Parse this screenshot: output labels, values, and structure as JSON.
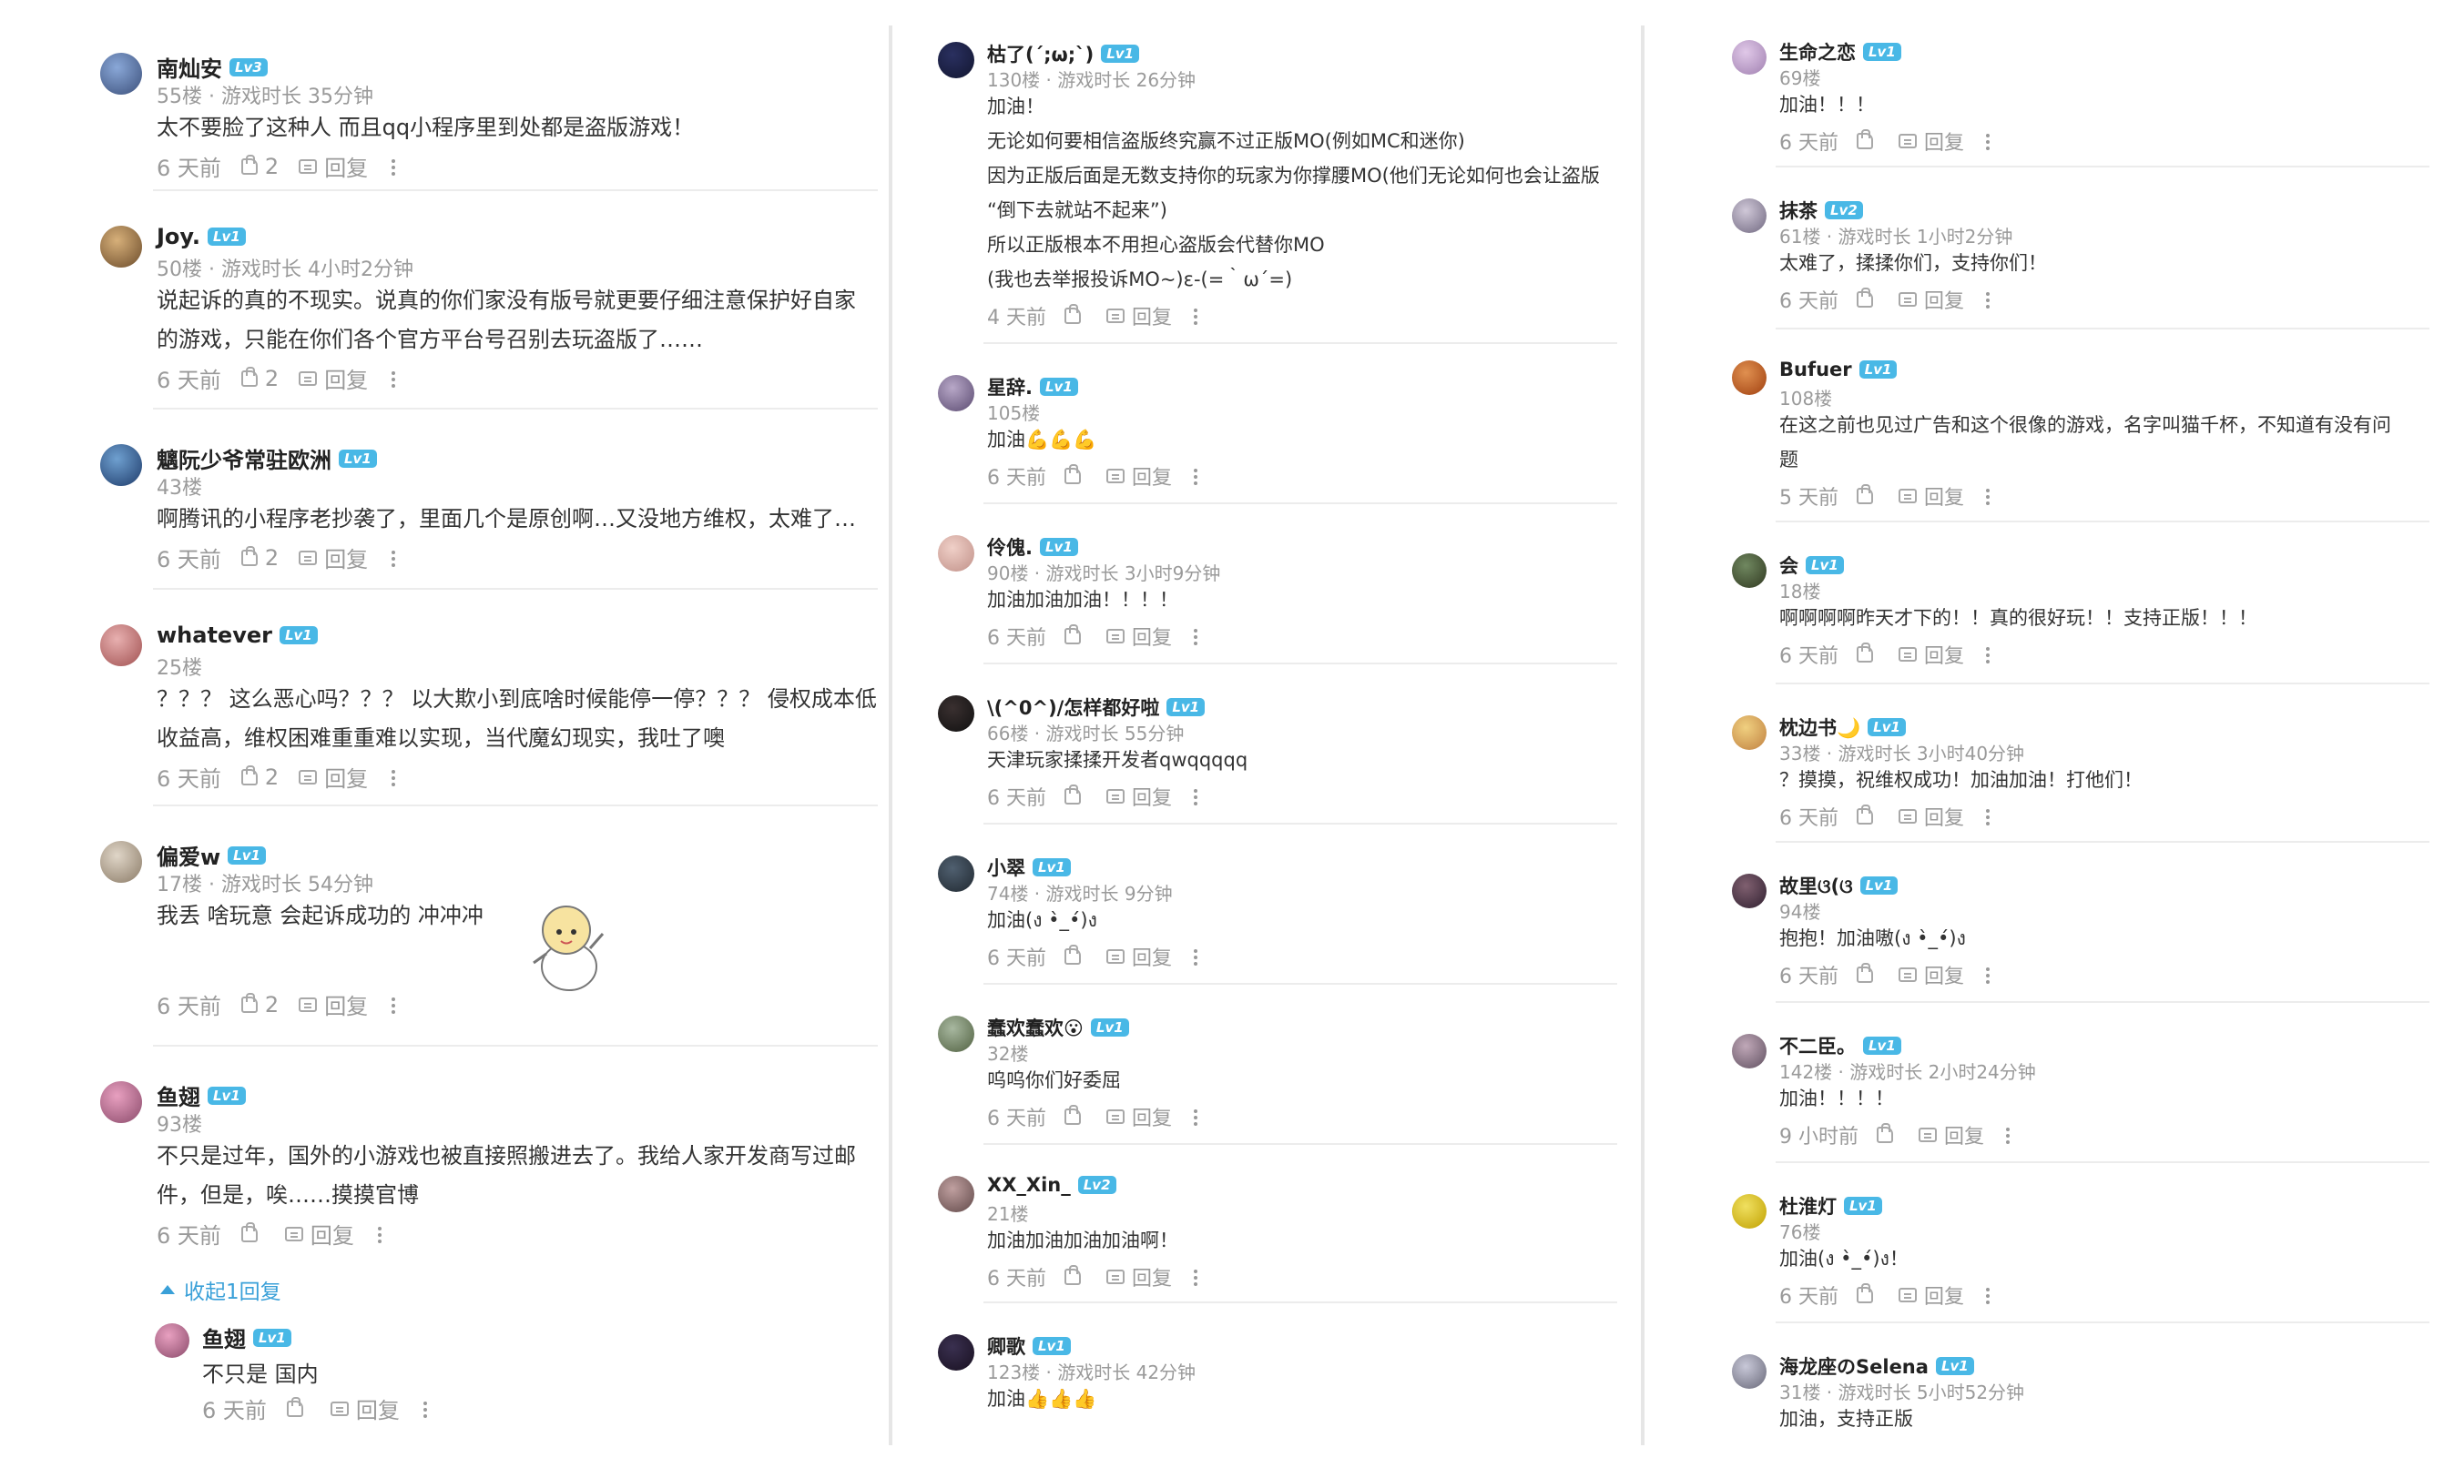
{
  "columns": [
    {
      "comments": [
        {
          "user": "南灿安",
          "level": "Lv3",
          "meta": "55楼 · 游戏时长 35分钟",
          "lines": [
            "太不要脸了这种人 而且qq小程序里到处都是盗版游戏！"
          ],
          "time": "6 天前",
          "likes": "2",
          "reply_label": "回复"
        },
        {
          "user": "Joy.",
          "level": "Lv1",
          "meta": "50楼 · 游戏时长 4小时2分钟",
          "lines": [
            "说起诉的真的不现实。说真的你们家没有版号就更要仔细注意保护好自家",
            "的游戏，只能在你们各个官方平台号召别去玩盗版了……"
          ],
          "time": "6 天前",
          "likes": "2",
          "reply_label": "回复"
        },
        {
          "user": "魑阮少爷常驻欧洲",
          "level": "Lv1",
          "meta": "43楼",
          "lines": [
            "啊腾讯的小程序老抄袭了，里面几个是原创啊…又没地方维权，太难了…"
          ],
          "time": "6 天前",
          "likes": "2",
          "reply_label": "回复"
        },
        {
          "user": "whatever",
          "level": "Lv1",
          "meta": "25楼",
          "lines": [
            "？？？ 这么恶心吗？？？ 以大欺小到底啥时候能停一停？？？ 侵权成本低",
            "收益高，维权困难重重难以实现，当代魔幻现实，我吐了噢"
          ],
          "time": "6 天前",
          "likes": "2",
          "reply_label": "回复"
        },
        {
          "user": "偏爱w",
          "level": "Lv1",
          "meta": "17楼 · 游戏时长 54分钟",
          "lines": [
            "我丢   啥玩意   会起诉成功的  冲冲冲"
          ],
          "time": "6 天前",
          "likes": "2",
          "reply_label": "回复"
        },
        {
          "user": "鱼翅",
          "level": "Lv1",
          "meta": "93楼",
          "lines": [
            "不只是过年，国外的小游戏也被直接照搬进去了。我给人家开发商写过邮",
            "件，但是，唉……摸摸官博"
          ],
          "time": "6 天前",
          "likes": "",
          "reply_label": "回复"
        }
      ],
      "collapse_label": "收起1回复",
      "sub_reply": {
        "user": "鱼翅",
        "level": "Lv1",
        "text": "不只是 国内",
        "time": "6 天前",
        "reply_label": "回复"
      }
    },
    {
      "comments": [
        {
          "user": "枯了(´;ω;`)",
          "level": "Lv1",
          "meta": "130楼 · 游戏时长 26分钟",
          "lines": [
            "加油！",
            "无论如何要相信盗版终究赢不过正版MO(例如MC和迷你)",
            "因为正版后面是无数支持你的玩家为你撑腰MO(他们无论如何也会让盗版",
            "“倒下去就站不起来”)",
            "所以正版根本不用担心盗版会代替你MO",
            "(我也去举报投诉MO~)ε-(=｀ω´=)"
          ],
          "time": "4 天前",
          "likes": "",
          "reply_label": "回复"
        },
        {
          "user": "星辞.",
          "level": "Lv1",
          "meta": "105楼",
          "lines": [
            "加油💪💪💪"
          ],
          "time": "6 天前",
          "likes": "",
          "reply_label": "回复"
        },
        {
          "user": "伶傀.",
          "level": "Lv1",
          "meta": "90楼 · 游戏时长 3小时9分钟",
          "lines": [
            "加油加油加油！！！！"
          ],
          "time": "6 天前",
          "likes": "",
          "reply_label": "回复"
        },
        {
          "user": "\\(^0^)/怎样都好啦",
          "level": "Lv1",
          "meta": "66楼 · 游戏时长 55分钟",
          "lines": [
            "天津玩家揉揉开发者qwqqqqq"
          ],
          "time": "6 天前",
          "likes": "",
          "reply_label": "回复"
        },
        {
          "user": "小翠",
          "level": "Lv1",
          "meta": "74楼 · 游戏时长 9分钟",
          "lines": [
            "加油(ง •̀_•́)ง"
          ],
          "time": "6 天前",
          "likes": "",
          "reply_label": "回复"
        },
        {
          "user": "蠢欢蠢欢😮",
          "level": "Lv1",
          "meta": "32楼",
          "lines": [
            "呜呜你们好委屈"
          ],
          "time": "6 天前",
          "likes": "",
          "reply_label": "回复"
        },
        {
          "user": "XX_Xin_",
          "level": "Lv2",
          "meta": "21楼",
          "lines": [
            "加油加油加油加油啊！"
          ],
          "time": "6 天前",
          "likes": "",
          "reply_label": "回复"
        },
        {
          "user": "卿歌",
          "level": "Lv1",
          "meta": "123楼 · 游戏时长 42分钟",
          "lines": [
            "加油👍👍👍"
          ],
          "time": "",
          "likes": "",
          "reply_label": ""
        }
      ]
    },
    {
      "comments": [
        {
          "user": "生命之恋",
          "level": "Lv1",
          "meta": "69楼",
          "lines": [
            "加油！！！"
          ],
          "time": "6 天前",
          "likes": "",
          "reply_label": "回复"
        },
        {
          "user": "抹茶",
          "level": "Lv2",
          "meta": "61楼 · 游戏时长 1小时2分钟",
          "lines": [
            "太难了，揉揉你们，支持你们！"
          ],
          "time": "6 天前",
          "likes": "",
          "reply_label": "回复"
        },
        {
          "user": "Bufuer",
          "level": "Lv1",
          "meta": "108楼",
          "lines": [
            "在这之前也见过广告和这个很像的游戏，名字叫猫千杯，不知道有没有问",
            "题"
          ],
          "time": "5 天前",
          "likes": "",
          "reply_label": "回复"
        },
        {
          "user": "会",
          "level": "Lv1",
          "meta": "18楼",
          "lines": [
            "啊啊啊啊昨天才下的！！真的很好玩！！支持正版！！！"
          ],
          "time": "6 天前",
          "likes": "",
          "reply_label": "回复"
        },
        {
          "user": "枕边书🌙",
          "level": "Lv1",
          "meta": "33楼 · 游戏时长 3小时40分钟",
          "lines": [
            "？摸摸，祝维权成功！加油加油！打他们！"
          ],
          "time": "6 天前",
          "likes": "",
          "reply_label": "回复"
        },
        {
          "user": "故里ଓ(ଓ",
          "level": "Lv1",
          "meta": "94楼",
          "lines": [
            "抱抱！加油嗷(ง •̀_•́)ง"
          ],
          "time": "6 天前",
          "likes": "",
          "reply_label": "回复"
        },
        {
          "user": "不二臣。",
          "level": "Lv1",
          "meta": "142楼 · 游戏时长 2小时24分钟",
          "lines": [
            "加油！！！！"
          ],
          "time": "9 小时前",
          "likes": "",
          "reply_label": "回复"
        },
        {
          "user": "杜淮灯",
          "level": "Lv1",
          "meta": "76楼",
          "lines": [
            "加油(ง •̀_•́)ง！"
          ],
          "time": "6 天前",
          "likes": "",
          "reply_label": "回复"
        },
        {
          "user": "海龙座のSelena",
          "level": "Lv1",
          "meta": "31楼 · 游戏时长 5小时52分钟",
          "lines": [
            "加油，支持正版"
          ],
          "time": "",
          "likes": "",
          "reply_label": ""
        }
      ]
    }
  ]
}
